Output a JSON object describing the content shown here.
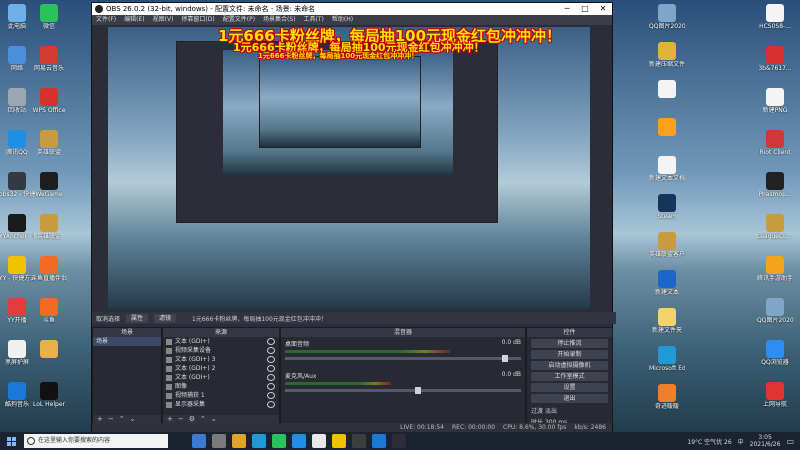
{
  "desktop": {
    "left_icons": [
      {
        "label": "此电脑",
        "color": "#6fb0e8"
      },
      {
        "label": "网络",
        "color": "#4a90d9"
      },
      {
        "label": "回收站",
        "color": "#9aa6b2"
      },
      {
        "label": "腾讯QQ",
        "color": "#1e8ee6"
      },
      {
        "label": "obs32 - 快捷方式",
        "color": "#333a44"
      },
      {
        "label": "YYAnchor - 快捷方式",
        "color": "#1a1a1a"
      },
      {
        "label": "YY - 快捷方式",
        "color": "#f2c200"
      },
      {
        "label": "YY开播",
        "color": "#e23c3c"
      },
      {
        "label": "黑屏护屏",
        "color": "#f0f0f0"
      },
      {
        "label": "酷狗音乐",
        "color": "#1a78d8"
      }
    ],
    "left2_icons": [
      {
        "label": "微信",
        "color": "#2ac25a"
      },
      {
        "label": "网易云音乐",
        "color": "#d33a31"
      },
      {
        "label": "WPS Office",
        "color": "#d8302d"
      },
      {
        "label": "英雄联盟",
        "color": "#c89b3c"
      },
      {
        "label": "WeGame",
        "color": "#1e1e1e"
      },
      {
        "label": "英雄联盟",
        "color": "#c89b3c"
      },
      {
        "label": "斗鱼直播伴侣",
        "color": "#f36a23"
      },
      {
        "label": "斗鱼",
        "color": "#f36a23"
      },
      {
        "label": "",
        "color": "#e8b14c"
      },
      {
        "label": "LoL Helper",
        "color": "#111"
      }
    ],
    "right_icons": [
      {
        "label": "QQ图片2020101...",
        "color": "#7fa6c8"
      },
      {
        "label": "新建压缩文件",
        "color": "#e0b33a"
      },
      {
        "label": "",
        "color": "#f4f4f4"
      },
      {
        "label": "",
        "color": "#ff9f1a"
      },
      {
        "label": "新建文本文档",
        "color": "#f4f4f4"
      },
      {
        "label": "Steam",
        "color": "#17355a"
      },
      {
        "label": "英雄联盟客户端",
        "color": "#c89b3c"
      },
      {
        "label": "新建文本",
        "color": "#1b67c9"
      },
      {
        "label": "新建文件夹",
        "color": "#f4d36a"
      },
      {
        "label": "Microsoft Edge",
        "color": "#1e9bd7"
      },
      {
        "label": "奇迹暖暖",
        "color": "#f07f2a"
      }
    ],
    "far_right_icons": [
      {
        "label": "HCS0S8-...",
        "color": "#f4f4f4"
      },
      {
        "label": "3b&7617...",
        "color": "#d92f2f"
      },
      {
        "label": "新建PNG",
        "color": "#f4f4f4"
      },
      {
        "label": "Riot Client",
        "color": "#d13639"
      },
      {
        "label": "Phasmop...",
        "color": "#222"
      },
      {
        "label": "LeagueCl... - 快捷方式",
        "color": "#c89b3c"
      },
      {
        "label": "腾讯手游助手",
        "color": "#f2a41c"
      },
      {
        "label": "QQ图片2020101...",
        "color": "#7fa6c8"
      },
      {
        "label": "QQ浏览器",
        "color": "#2b8ef0"
      },
      {
        "label": "上网导航",
        "color": "#e23333"
      }
    ]
  },
  "obs": {
    "title": "OBS 26.0.2 (32-bit, windows) - 配置文件: 未命名 - 场景: 未命名",
    "menu": [
      "文件(F)",
      "编辑(E)",
      "视图(V)",
      "停靠窗口(D)",
      "配置文件(P)",
      "场景集合(S)",
      "工具(T)",
      "帮助(H)"
    ],
    "banner": "1元666卡粉丝牌，每局抽100元现金红包冲冲冲！",
    "toolbar": {
      "source_label": "取消选择",
      "props": "属性",
      "filters": "滤镜",
      "ticker": "1元666卡粉丝牌，每局抽100元现金红包冲冲冲！"
    },
    "docks": {
      "scenes_title": "场景",
      "sources_title": "来源",
      "mixer_title": "混音器",
      "controls_title": "控件"
    },
    "scenes": [
      "场景"
    ],
    "sources": [
      "文本 (GDI+)",
      "视频采集设备",
      "文本 (GDI+) 3",
      "文本 (GDI+) 2",
      "文本 (GDI+)",
      "图像",
      "视频捕获 1",
      "显示器采集"
    ],
    "mixer": [
      {
        "name": "桌面音频",
        "db": "0.0 dB",
        "level": 0.7,
        "vol": 0.92
      },
      {
        "name": "麦克风/Aux",
        "db": "0.0 dB",
        "level": 0.45,
        "vol": 0.55
      }
    ],
    "controls": [
      "停止推流",
      "开始录制",
      "启动虚拟摄像机",
      "工作室模式",
      "设置",
      "退出"
    ],
    "transition": {
      "label": "过渡",
      "value": "淡出",
      "duration_label": "时长",
      "duration": "300 ms"
    },
    "status": {
      "live": "LIVE: 00:18:54",
      "rec": "REC: 00:00:00",
      "cpu": "CPU: 8.6%, 30.00 fps",
      "kb": "kb/s: 2486"
    }
  },
  "taskbar": {
    "search_placeholder": "在这里输入你要搜索的内容",
    "apps": [
      "#3a7bd5",
      "#7a7a7a",
      "#e3a32b",
      "#1e9bd7",
      "#2ac25a",
      "#1e8ee6",
      "#e8e8e8",
      "#f2c200",
      "#3e3e3e",
      "#1a78d8",
      "#2b2e38"
    ],
    "weather": "19°C 空气优 26",
    "lang": "中",
    "time": "3:05",
    "date": "2021/6/26"
  }
}
